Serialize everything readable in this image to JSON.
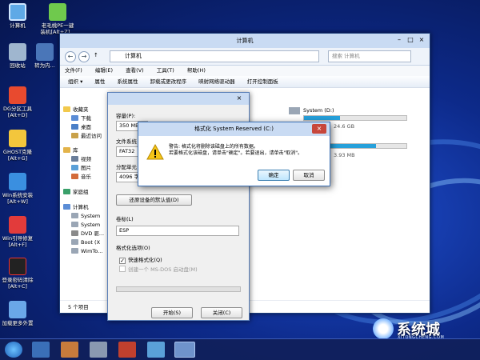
{
  "desktop": {
    "icons": [
      {
        "label": "计算机"
      },
      {
        "label": "老毛桃PE一键",
        "label2": "装机[Alt+Z]..."
      },
      {
        "label": "回收站"
      },
      {
        "label": "转为内..."
      },
      {
        "label": "DG分区工具",
        "label2": "[Alt+D]"
      },
      {
        "label": "GHOST克隆",
        "label2": "[Alt+G]"
      },
      {
        "label": "Win系统安装",
        "label2": "[Alt+W]"
      },
      {
        "label": "Win引导修复",
        "label2": "[Alt+F]"
      },
      {
        "label": "登录密码清除",
        "label2": "[Alt+C]"
      },
      {
        "label": "加载更多外置"
      }
    ],
    "watermark": {
      "brand": "系统城",
      "site": "XITONGCHENG.COM"
    }
  },
  "explorer": {
    "title": "计算机",
    "address": "计算机",
    "search_placeholder": "搜索 计算机",
    "menu": [
      "文件(F)",
      "编辑(E)",
      "查看(V)",
      "工具(T)",
      "帮助(H)"
    ],
    "commands": [
      "组织 ▾",
      "属性",
      "系统属性",
      "卸载或更改程序",
      "映射网络驱动器",
      "打开控制面板"
    ],
    "nav": [
      "收藏夹",
      "下载",
      "桌面",
      "最近访问",
      "库",
      "视频",
      "图片",
      "音乐",
      "家庭组",
      "计算机",
      "System",
      "System",
      "DVD 驱...",
      "Boot (X",
      "WimTo..."
    ],
    "drives": [
      {
        "name": "System (D:)",
        "free": "24.6 GB",
        "fill": 0.35
      },
      {
        "name": "",
        "free": "3.93 MB",
        "fill": 0.7
      }
    ],
    "status": "5 个项目"
  },
  "format_dialog": {
    "title": "格式化 System Reserved (C:)",
    "capacity_label": "容量(P):",
    "capacity_value": "350 MB",
    "fs_label": "文件系统",
    "fs_value": "FAT32",
    "alloc_label": "分配单元",
    "alloc_value": "4096 字节",
    "restore_button": "还原设备的默认值(D)",
    "volume_label": "卷标(L)",
    "volume_value": "ESP",
    "options_label": "格式化选项(O)",
    "quick_format": "快速格式化(Q)",
    "msdos_disk": "创建一个 MS-DOS 启动盘(M)",
    "start_button": "开始(S)",
    "close_button": "关闭(C)"
  },
  "warning_dialog": {
    "title": "格式化 System Reserved (C:)",
    "line1": "警告: 格式化将删除该磁盘上的所有数据。",
    "line2": "若要格式化该磁盘，请单击\"确定\"。若要退出，请单击\"取消\"。",
    "ok_button": "确定",
    "cancel_button": "取消"
  }
}
